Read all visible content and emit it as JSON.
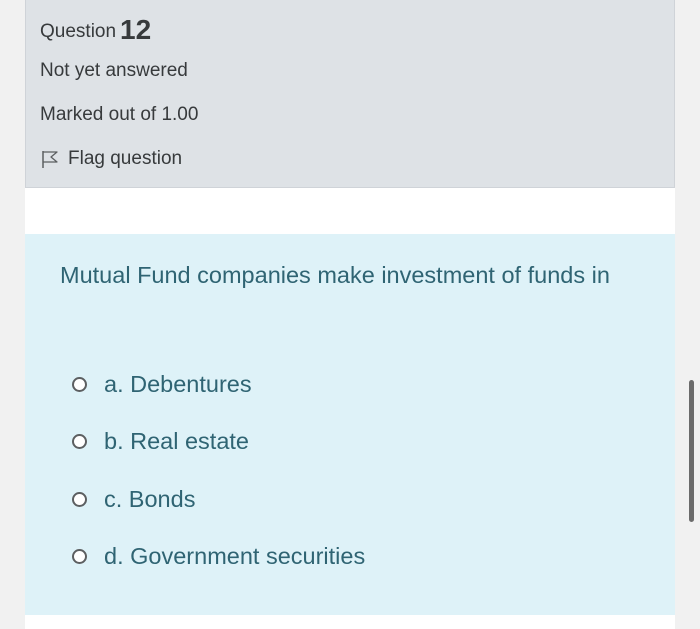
{
  "question": {
    "label": "Question",
    "number": "12",
    "state": "Not yet answered",
    "grade": "Marked out of 1.00",
    "flag_label": "Flag question",
    "flag_icon": "flag-icon"
  },
  "content": {
    "text": "Mutual Fund companies make investment of funds in",
    "answers": [
      {
        "label": "a. Debentures"
      },
      {
        "label": "b. Real estate"
      },
      {
        "label": "c. Bonds"
      },
      {
        "label": "d. Government securities"
      }
    ]
  },
  "colors": {
    "info_background": "#dee2e6",
    "question_background": "#def2f8",
    "question_text": "#2f6473"
  }
}
